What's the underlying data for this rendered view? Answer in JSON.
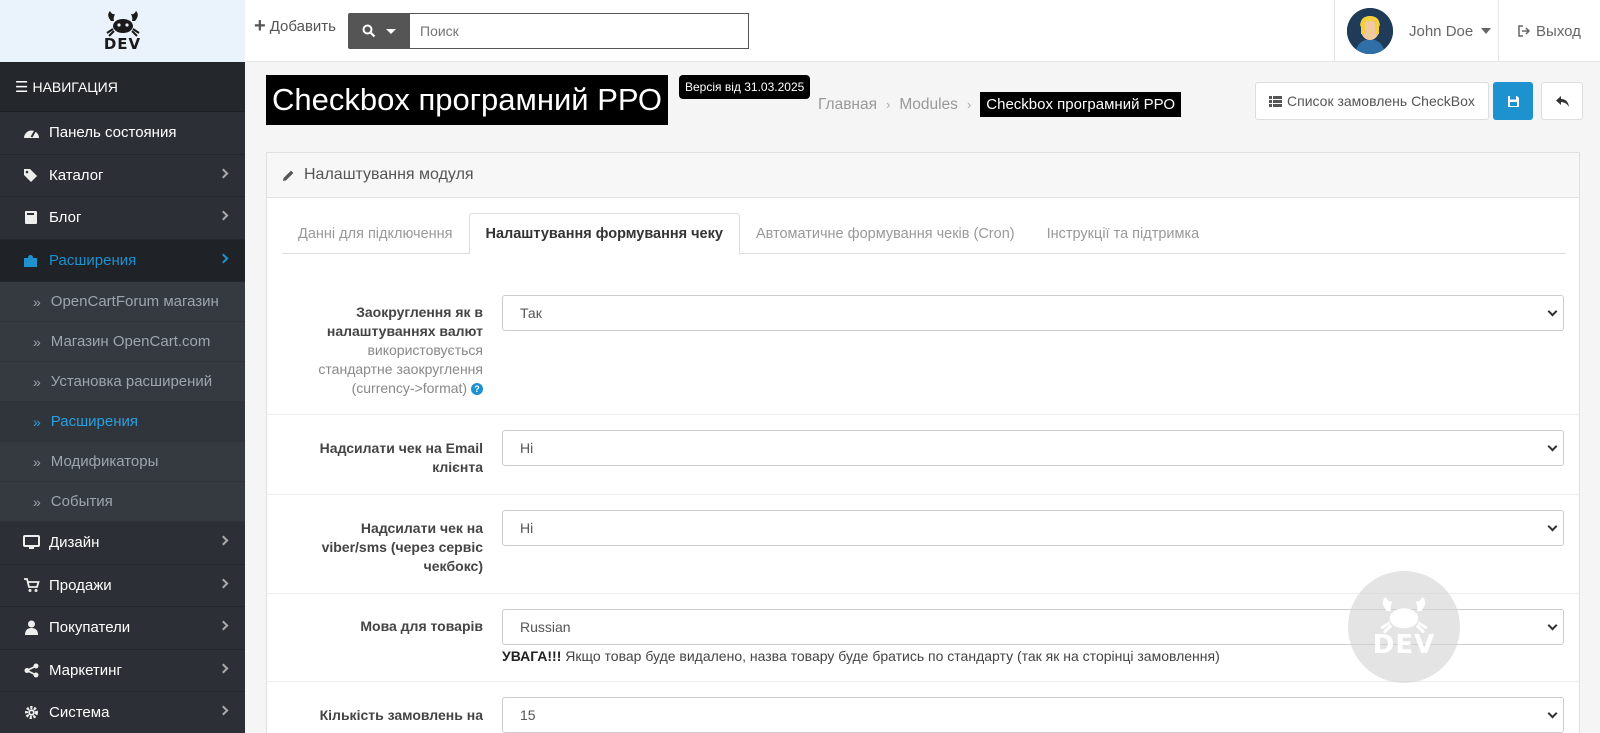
{
  "header": {
    "logo_text": "DEV",
    "add_label": "Добавить",
    "search_placeholder": "Поиск",
    "user_name": "John Doe",
    "logout_label": "Выход"
  },
  "sidebar": {
    "nav_title": "НАВИГАЦИЯ",
    "items": [
      {
        "label": "Панель состояния",
        "icon": "dashboard-icon"
      },
      {
        "label": "Каталог",
        "icon": "tags-icon"
      },
      {
        "label": "Блог",
        "icon": "book-icon"
      },
      {
        "label": "Расширения",
        "icon": "puzzle-icon"
      }
    ],
    "subitems": [
      {
        "label": "OpenCartForum магазин"
      },
      {
        "label": "Магазин OpenCart.com"
      },
      {
        "label": "Установка расширений"
      },
      {
        "label": "Расширения"
      },
      {
        "label": "Модификаторы"
      },
      {
        "label": "События"
      }
    ],
    "items_bottom": [
      {
        "label": "Дизайн",
        "icon": "monitor-icon"
      },
      {
        "label": "Продажи",
        "icon": "cart-icon"
      },
      {
        "label": "Покупатели",
        "icon": "user-icon"
      },
      {
        "label": "Маркетинг",
        "icon": "share-icon"
      },
      {
        "label": "Система",
        "icon": "gear-icon"
      }
    ]
  },
  "page": {
    "title": "Checkbox програмний РРО",
    "version": "Версія від 31.03.2025",
    "breadcrumb": [
      "Главная",
      "Modules",
      "Checkbox програмний РРО"
    ],
    "orders_button": "Список замовлень CheckBox"
  },
  "panel": {
    "heading": "Налаштування модуля",
    "tabs": [
      "Данні для підключення",
      "Налаштування формування чеку",
      "Автоматичне формування чеків (Cron)",
      "Інструкції та підтримка"
    ],
    "fields": [
      {
        "label": "Заокруглення як в налаштуваннях валют",
        "help": "використовується стандартне заокруглення (currency->format)",
        "value": "Так"
      },
      {
        "label": "Надсилати чек на Email клієнта",
        "value": "Ні"
      },
      {
        "label": "Надсилати чек на viber/sms (через сервіс чекбокс)",
        "value": "Ні"
      },
      {
        "label": "Мова для товарів",
        "value": "Russian",
        "warning_bold": "УВАГА!!!",
        "warning_text": " Якщо товар буде видалено, назва товару буде братись по стандарту (так як на сторінці замовлення)"
      },
      {
        "label": "Кількість замовлень на",
        "value": "15"
      }
    ]
  },
  "colors": {
    "accent": "#1e91cf",
    "sidebar_bg": "#2c3036"
  }
}
